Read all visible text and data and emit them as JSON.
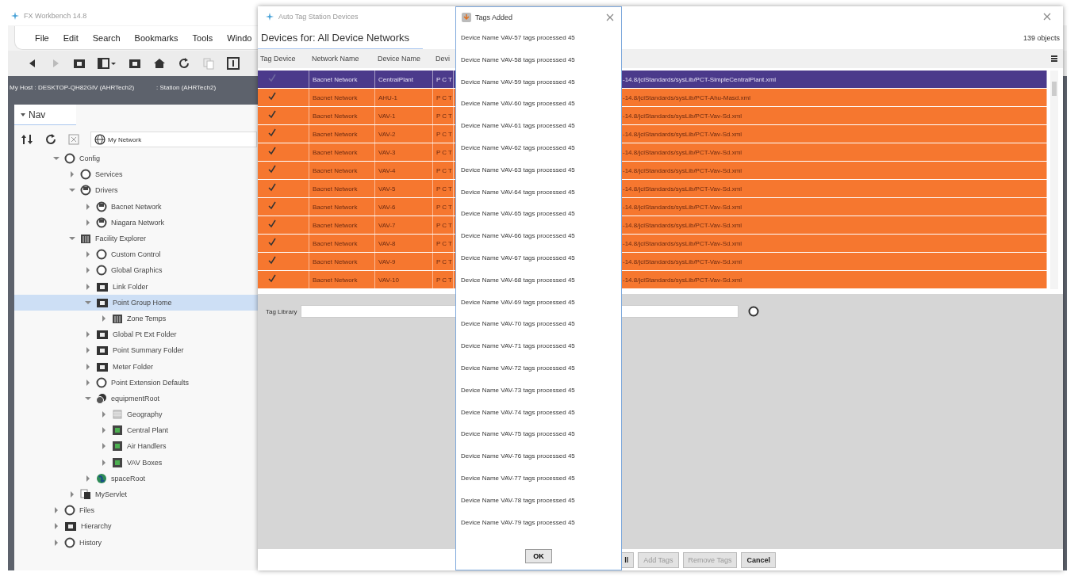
{
  "main_window": {
    "title": "FX Workbench 14.8",
    "menu": [
      "File",
      "Edit",
      "Search",
      "Bookmarks",
      "Tools",
      "Windo"
    ],
    "host": "My Host : DESKTOP-QH82GIV (AHRTech2)",
    "station": ": Station (AHRTech2)"
  },
  "nav": {
    "tab": "Nav",
    "location": "My Network",
    "tree": [
      {
        "label": "Config",
        "kind": "ring",
        "expanded": true,
        "selected": false,
        "children": [
          {
            "label": "Services",
            "kind": "ring",
            "expanded": false,
            "selected": false
          },
          {
            "label": "Drivers",
            "kind": "driver",
            "expanded": true,
            "selected": false,
            "children": [
              {
                "label": "Bacnet Network",
                "kind": "driver",
                "expanded": false,
                "selected": false
              },
              {
                "label": "Niagara Network",
                "kind": "driver",
                "expanded": false,
                "selected": false
              }
            ]
          },
          {
            "label": "Facility Explorer",
            "kind": "facility",
            "expanded": true,
            "selected": false,
            "children": [
              {
                "label": "Custom Control",
                "kind": "ring",
                "expanded": false,
                "selected": false
              },
              {
                "label": "Global Graphics",
                "kind": "ring",
                "expanded": false,
                "selected": false
              },
              {
                "label": "Link Folder",
                "kind": "folder",
                "expanded": false,
                "selected": false
              },
              {
                "label": "Point Group Home",
                "kind": "folder",
                "expanded": true,
                "selected": true,
                "children": [
                  {
                    "label": "Zone Temps",
                    "kind": "facility",
                    "expanded": false,
                    "selected": false
                  }
                ]
              },
              {
                "label": "Global Pt Ext Folder",
                "kind": "folder",
                "expanded": false,
                "selected": false
              },
              {
                "label": "Point Summary Folder",
                "kind": "folder",
                "expanded": false,
                "selected": false
              },
              {
                "label": "Meter Folder",
                "kind": "folder",
                "expanded": false,
                "selected": false
              },
              {
                "label": "Point Extension Defaults",
                "kind": "ring",
                "expanded": false,
                "selected": false
              },
              {
                "label": "equipmentRoot",
                "kind": "equipment",
                "expanded": true,
                "selected": false,
                "children": [
                  {
                    "label": "Geography",
                    "kind": "geography",
                    "expanded": false,
                    "selected": false
                  },
                  {
                    "label": "Central Plant",
                    "kind": "site",
                    "expanded": false,
                    "selected": false
                  },
                  {
                    "label": "Air Handlers",
                    "kind": "site",
                    "expanded": false,
                    "selected": false
                  },
                  {
                    "label": "VAV Boxes",
                    "kind": "site",
                    "expanded": false,
                    "selected": false
                  }
                ]
              },
              {
                "label": "spaceRoot",
                "kind": "space",
                "expanded": false,
                "selected": false
              }
            ]
          },
          {
            "label": "MyServlet",
            "kind": "servlet",
            "expanded": false,
            "selected": false
          }
        ]
      },
      {
        "label": "Files",
        "kind": "ring",
        "expanded": false,
        "selected": false
      },
      {
        "label": "Hierarchy",
        "kind": "folder",
        "expanded": false,
        "selected": false
      },
      {
        "label": "History",
        "kind": "ring",
        "expanded": false,
        "selected": false
      }
    ]
  },
  "device_dialog": {
    "title": "Auto Tag Station Devices",
    "heading": "Devices for: All Device Networks",
    "object_count": "139 objects",
    "table": {
      "columns": [
        "Tag Device",
        "Network Name",
        "Device Name",
        "Devi"
      ],
      "rows": [
        {
          "selected": true,
          "checked": true,
          "network": "Bacnet Network",
          "device": "CentralPlant",
          "column_4": "PCT",
          "column_5": "-14.8/jciStandards/sysLib/PCT-SimpleCentralPlant.xml"
        },
        {
          "selected": false,
          "checked": true,
          "network": "Bacnet Network",
          "device": "AHU-1",
          "column_4": "PCT",
          "column_5": "-14.8/jciStandards/sysLib/PCT-Ahu-Masd.xml"
        },
        {
          "selected": false,
          "checked": true,
          "network": "Bacnet Network",
          "device": "VAV-1",
          "column_4": "PCT",
          "column_5": "-14.8/jciStandards/sysLib/PCT-Vav-Sd.xml"
        },
        {
          "selected": false,
          "checked": true,
          "network": "Bacnet Network",
          "device": "VAV-2",
          "column_4": "PCT",
          "column_5": "-14.8/jciStandards/sysLib/PCT-Vav-Sd.xml"
        },
        {
          "selected": false,
          "checked": true,
          "network": "Bacnet Network",
          "device": "VAV-3",
          "column_4": "PCT",
          "column_5": "-14.8/jciStandards/sysLib/PCT-Vav-Sd.xml"
        },
        {
          "selected": false,
          "checked": true,
          "network": "Bacnet Network",
          "device": "VAV-4",
          "column_4": "PCT",
          "column_5": "-14.8/jciStandards/sysLib/PCT-Vav-Sd.xml"
        },
        {
          "selected": false,
          "checked": true,
          "network": "Bacnet Network",
          "device": "VAV-5",
          "column_4": "PCT",
          "column_5": "-14.8/jciStandards/sysLib/PCT-Vav-Sd.xml"
        },
        {
          "selected": false,
          "checked": true,
          "network": "Bacnet Network",
          "device": "VAV-6",
          "column_4": "PCT",
          "column_5": "-14.8/jciStandards/sysLib/PCT-Vav-Sd.xml"
        },
        {
          "selected": false,
          "checked": true,
          "network": "Bacnet Network",
          "device": "VAV-7",
          "column_4": "PCT",
          "column_5": "-14.8/jciStandards/sysLib/PCT-Vav-Sd.xml"
        },
        {
          "selected": false,
          "checked": true,
          "network": "Bacnet Network",
          "device": "VAV-8",
          "column_4": "PCT",
          "column_5": "-14.8/jciStandards/sysLib/PCT-Vav-Sd.xml"
        },
        {
          "selected": false,
          "checked": true,
          "network": "Bacnet Network",
          "device": "VAV-9",
          "column_4": "PCT",
          "column_5": "-14.8/jciStandards/sysLib/PCT-Vav-Sd.xml"
        },
        {
          "selected": false,
          "checked": true,
          "network": "Bacnet Network",
          "device": "VAV-10",
          "column_4": "PCT",
          "column_5": "-14.8/jciStandards/sysLib/PCT-Vav-Sd.xml"
        }
      ]
    },
    "tag_library_label": "Tag Library",
    "buttons": [
      {
        "label": "ll",
        "disabled": false
      },
      {
        "label": "Add Tags",
        "disabled": true
      },
      {
        "label": "Remove Tags",
        "disabled": true
      },
      {
        "label": "Cancel",
        "disabled": false
      }
    ]
  },
  "tags_dialog": {
    "title": "Tags Added",
    "lines": [
      "Device Name VAV-57 tags processed 45",
      "Device Name VAV-58 tags processed 45",
      "Device Name VAV-59 tags processed 45",
      "Device Name VAV-60 tags processed 45",
      "Device Name VAV-61 tags processed 45",
      "Device Name VAV-62 tags processed 45",
      "Device Name VAV-63 tags processed 45",
      "Device Name VAV-64 tags processed 45",
      "Device Name VAV-65 tags processed 45",
      "Device Name VAV-66 tags processed 45",
      "Device Name VAV-67 tags processed 45",
      "Device Name VAV-68 tags processed 45",
      "Device Name VAV-69 tags processed 45",
      "Device Name VAV-70 tags processed 45",
      "Device Name VAV-71 tags processed 45",
      "Device Name VAV-72 tags processed 45",
      "Device Name VAV-73 tags processed 45",
      "Device Name VAV-74 tags processed 45",
      "Device Name VAV-75 tags processed 45",
      "Device Name VAV-76 tags processed 45",
      "Device Name VAV-77 tags processed 45",
      "Device Name VAV-78 tags processed 45",
      "Device Name VAV-79 tags processed 45"
    ],
    "ok": "OK"
  }
}
